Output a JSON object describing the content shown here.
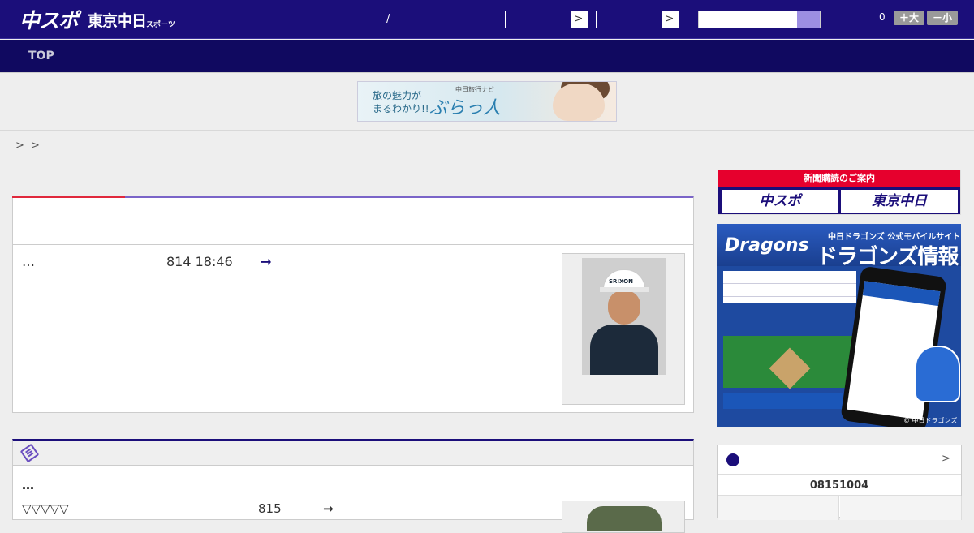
{
  "header": {
    "logo_main": "中スポ",
    "logo_sub": "東京中日",
    "logo_small": "スポーツ",
    "separator": "/",
    "select1_arrow": ">",
    "select2_arrow": ">",
    "font_count": "0",
    "font_larger": "＋大",
    "font_smaller": "－小"
  },
  "nav": {
    "top_label": "TOP"
  },
  "banner": {
    "line1": "旅の魅力が",
    "line2": "まるわかり!!",
    "brand": "ぶらっ人",
    "brand_small": "中日旅行ナビ"
  },
  "breadcrumb": {
    "sep1": ">",
    "sep2": ">"
  },
  "article1": {
    "ellipsis": "…",
    "date": "814 18:46",
    "arrow": "→",
    "photo_cap_text": "SRIXON"
  },
  "article2": {
    "dots": "…",
    "triangles": "▽▽▽▽▽",
    "num": "815",
    "arrow": "→"
  },
  "subscription": {
    "title": "新聞購読のご案内",
    "btn1": "中スポ",
    "btn2": "東京中日"
  },
  "dragons_ad": {
    "logo": "Dragons",
    "small": "中日ドラゴンズ 公式モバイルサイト",
    "big": "ドラゴンズ情報",
    "copyright": "© 中日ドラゴンズ"
  },
  "standings": {
    "chevron": ">",
    "date": "08151004"
  }
}
